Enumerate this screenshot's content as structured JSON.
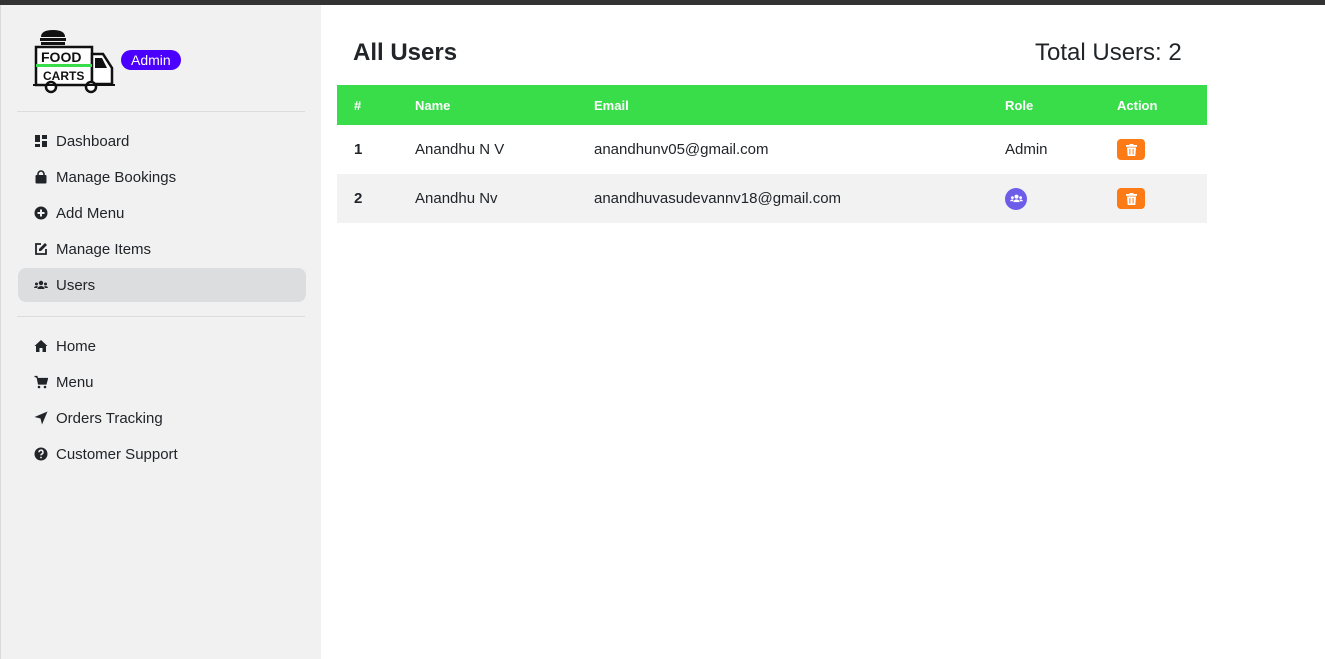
{
  "brand": {
    "logo_lines": [
      "FOOD",
      "CARTS"
    ],
    "badge": "Admin"
  },
  "sidebar": {
    "admin_items": [
      {
        "label": "Dashboard",
        "icon": "dashboard-icon"
      },
      {
        "label": "Manage Bookings",
        "icon": "shopping-bag-icon"
      },
      {
        "label": "Add Menu",
        "icon": "plus-circle-icon"
      },
      {
        "label": "Manage Items",
        "icon": "edit-icon"
      },
      {
        "label": "Users",
        "icon": "users-icon",
        "active": true
      }
    ],
    "site_items": [
      {
        "label": "Home",
        "icon": "home-icon"
      },
      {
        "label": "Menu",
        "icon": "cart-icon"
      },
      {
        "label": "Orders Tracking",
        "icon": "location-arrow-icon"
      },
      {
        "label": "Customer Support",
        "icon": "question-circle-icon"
      }
    ]
  },
  "main": {
    "title": "All Users",
    "total_users": "Total Users: 2",
    "table": {
      "headers": [
        "#",
        "Name",
        "Email",
        "Role",
        "Action"
      ],
      "rows": [
        {
          "num": "1",
          "name": "Anandhu N V",
          "email": "anandhunv05@gmail.com",
          "role": "Admin",
          "role_icon": null,
          "action_icon": "trash-icon"
        },
        {
          "num": "2",
          "name": "Anandhu Nv",
          "email": "anandhuvasudevannv18@gmail.com",
          "role": "",
          "role_icon": "users-icon",
          "action_icon": "trash-icon"
        }
      ]
    }
  },
  "colors": {
    "accent_green": "#39dd4a",
    "badge_purple": "#4b00ff",
    "delete_orange": "#fd7b16",
    "role_purple": "#6c5ce7"
  }
}
